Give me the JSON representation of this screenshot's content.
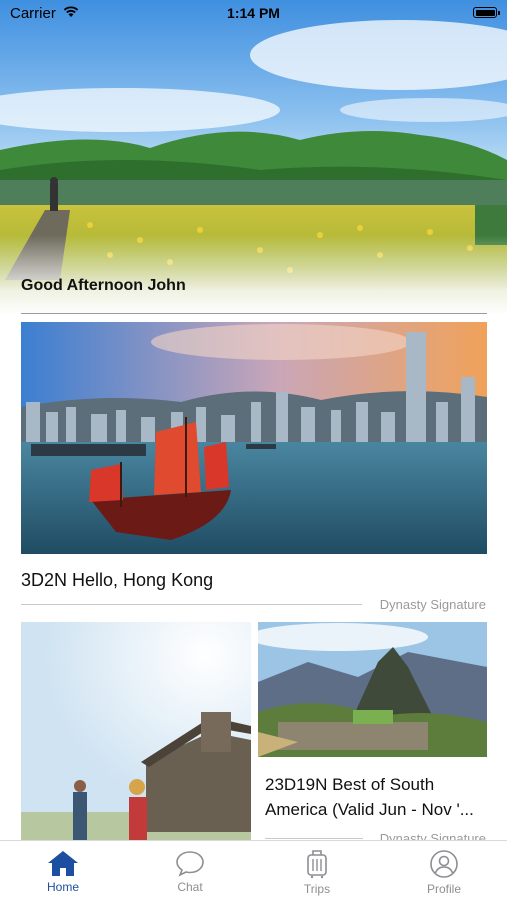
{
  "status_bar": {
    "carrier": "Carrier",
    "time": "1:14 PM"
  },
  "greeting": "Good Afternoon John",
  "featured": {
    "title": "3D2N Hello, Hong Kong",
    "tag": "Dynasty Signature"
  },
  "grid": {
    "right_card": {
      "title": "23D19N Best of South\nAmerica (Valid Jun - Nov '...",
      "tag": "Dynasty Signature"
    }
  },
  "tabs": [
    {
      "label": "Home",
      "icon": "home-icon",
      "active": true
    },
    {
      "label": "Chat",
      "icon": "chat-icon",
      "active": false
    },
    {
      "label": "Trips",
      "icon": "suitcase-icon",
      "active": false
    },
    {
      "label": "Profile",
      "icon": "profile-icon",
      "active": false
    }
  ],
  "colors": {
    "accent": "#1c4fa0",
    "inactive": "#8e8e93"
  }
}
